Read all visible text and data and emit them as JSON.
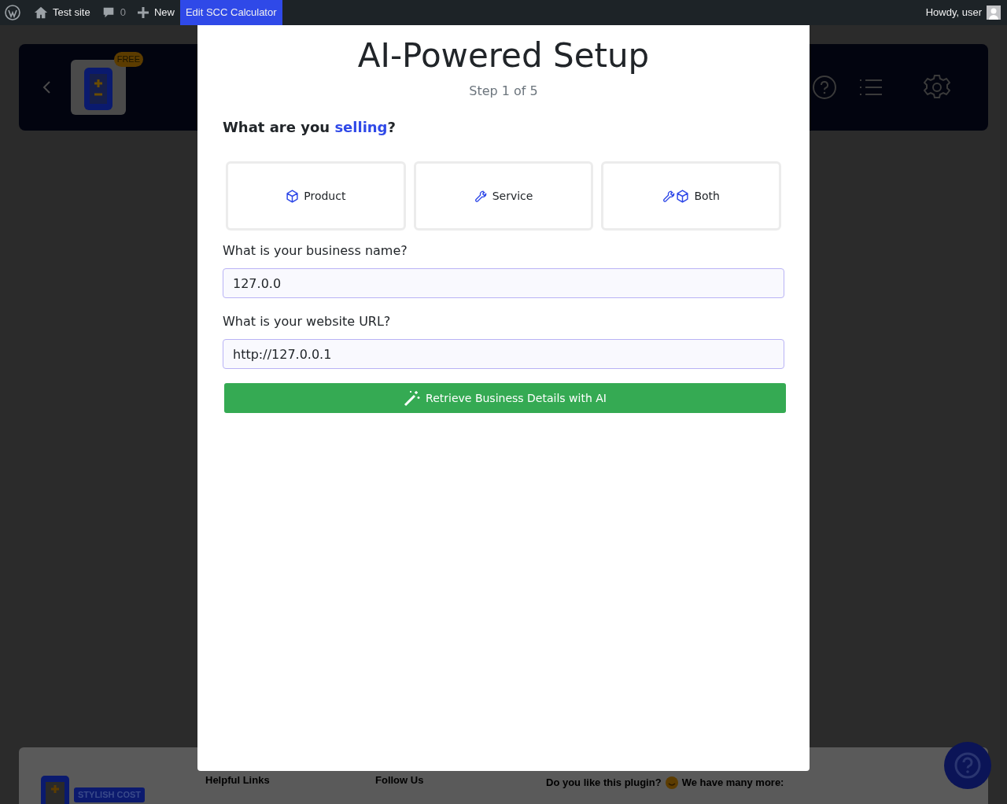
{
  "admin_bar": {
    "site": "Test site",
    "comments": "0",
    "new": "New",
    "current": "Edit SCC Calculator",
    "greeting": "Howdy, user"
  },
  "header": {
    "badge": "FREE"
  },
  "modal": {
    "title": "AI-Powered Setup",
    "step": "Step 1 of 5",
    "question": "What are you *selling*?",
    "options": [
      {
        "label": "Product",
        "kind": "product",
        "selected": false
      },
      {
        "label": "Service",
        "kind": "service",
        "selected": false
      },
      {
        "label": "Both",
        "kind": "both",
        "selected": false
      }
    ],
    "fields": [
      {
        "label": "What is your business name?",
        "value": "127.0.0"
      },
      {
        "label": "What is your website URL?",
        "value": "http://127.0.0.1"
      }
    ],
    "button": "Retrieve Business Details with AI"
  },
  "footer": {
    "logo_badge": "STYLISH COST",
    "helpful_links": "Helpful Links",
    "follow_us": "Follow Us",
    "prompt": "Do you like this plugin?",
    "prompt_end": "We have many more:"
  }
}
